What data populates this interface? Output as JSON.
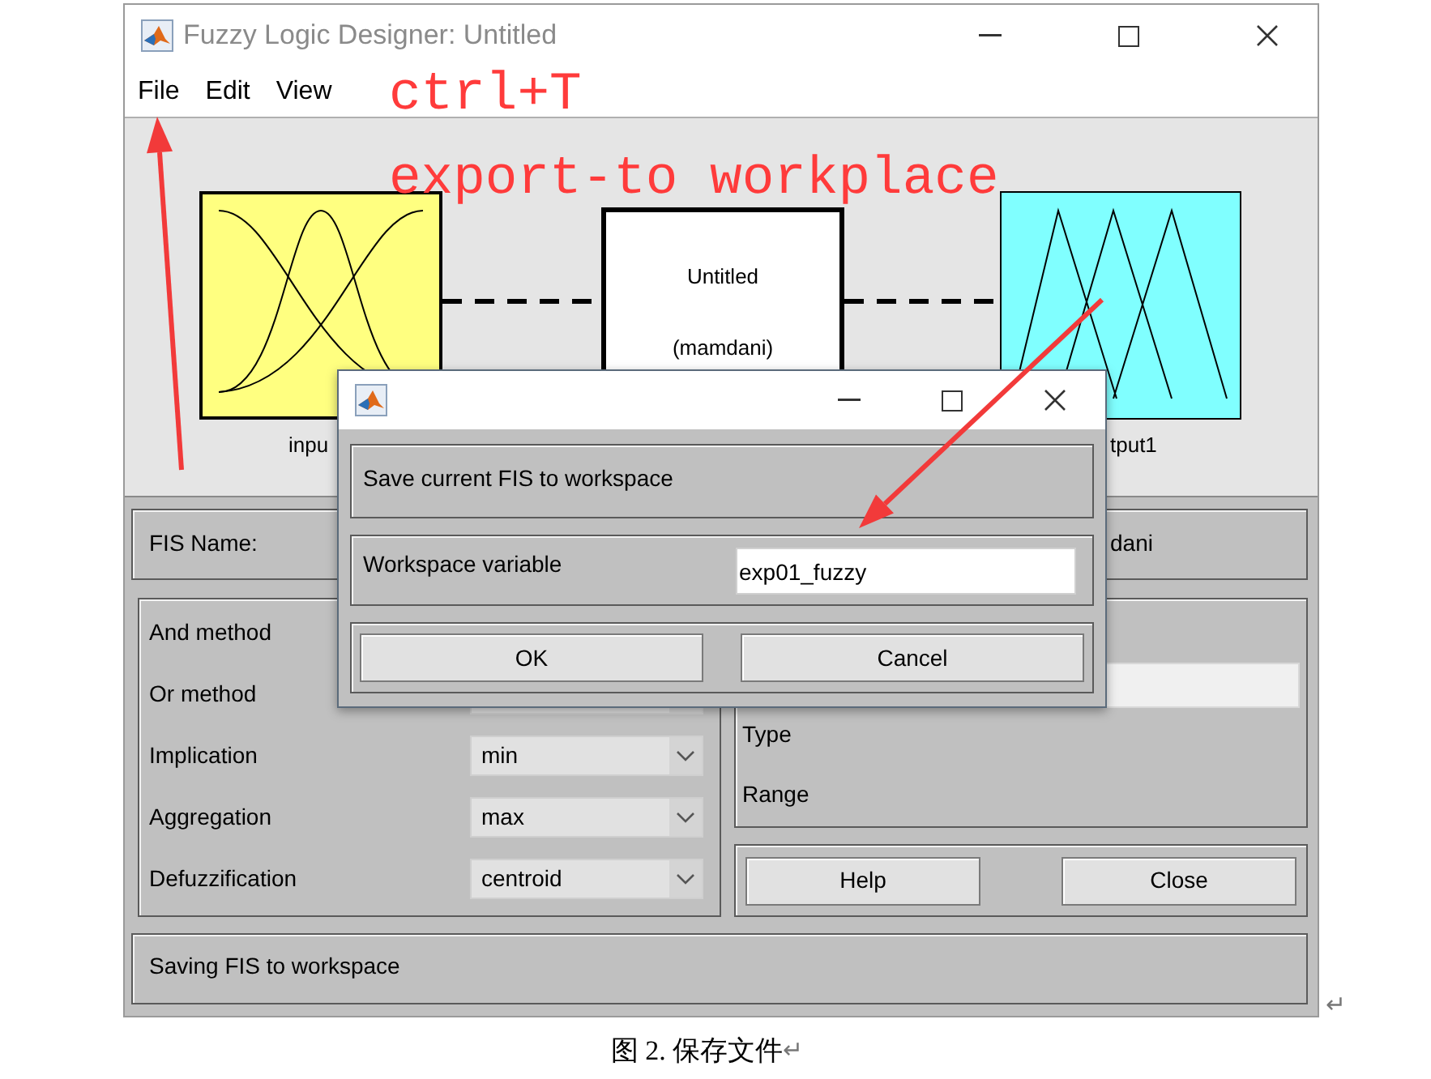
{
  "window": {
    "title": "Fuzzy Logic Designer: Untitled"
  },
  "menu": [
    "File",
    "Edit",
    "View"
  ],
  "annotations": [
    "ctrl+T",
    "export-to workplace"
  ],
  "diagram": {
    "input_label": "inpu",
    "system_name": "Untitled",
    "system_type": "(mamdani)",
    "output_label": "tput1"
  },
  "fis": {
    "name_label": "FIS Name:",
    "type_value": "dani"
  },
  "methods": [
    {
      "label": "And method"
    },
    {
      "label": "Or method",
      "dropdown": true
    },
    {
      "label": "Implication",
      "value": "min"
    },
    {
      "label": "Aggregation",
      "value": "max"
    },
    {
      "label": "Defuzzification",
      "value": "centroid"
    }
  ],
  "variable_panel": {
    "type_label": "Type",
    "range_label": "Range"
  },
  "buttons": [
    "Help",
    "Close"
  ],
  "status": "Saving FIS to workspace",
  "dialog": {
    "message": "Save current FIS to workspace",
    "field_label": "Workspace variable",
    "field_value": "exp01_fuzzy",
    "buttons": [
      "OK",
      "Cancel"
    ]
  },
  "caption": "图 2. 保存文件",
  "paragraph_marks": [
    "↵",
    "↵"
  ]
}
